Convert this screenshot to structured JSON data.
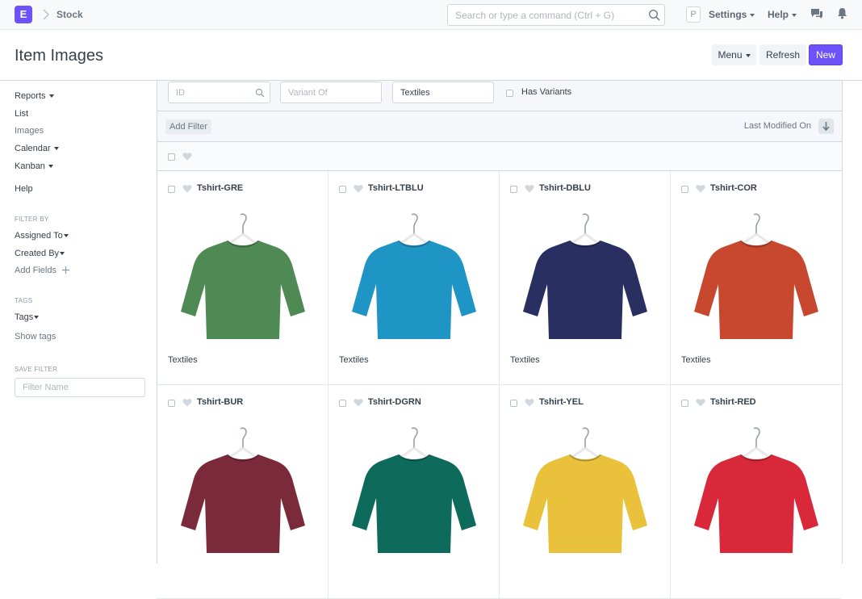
{
  "navbar": {
    "logo_letter": "E",
    "breadcrumb": "Stock",
    "search_placeholder": "Search or type a command (Ctrl + G)",
    "avatar_letter": "P",
    "settings_label": "Settings",
    "help_label": "Help"
  },
  "page": {
    "title": "Item Images",
    "menu_label": "Menu",
    "refresh_label": "Refresh",
    "new_label": "New"
  },
  "colors": {
    "accent": "#6d52fa"
  },
  "sidebar": {
    "reports": "Reports",
    "list": "List",
    "images": "Images",
    "calendar": "Calendar",
    "kanban": "Kanban",
    "help": "Help",
    "filter_by_heading": "FILTER BY",
    "assigned_to": "Assigned To",
    "created_by": "Created By",
    "add_fields": "Add Fields",
    "tags_heading": "TAGS",
    "tags": "Tags",
    "show_tags": "Show tags",
    "save_filter_heading": "SAVE FILTER",
    "filter_name_placeholder": "Filter Name"
  },
  "filters": {
    "id_placeholder": "ID",
    "variant_of_placeholder": "Variant Of",
    "item_group_value": "Textiles",
    "has_variants_label": "Has Variants"
  },
  "toolbar": {
    "add_filter": "Add Filter",
    "sort_label": "Last Modified On"
  },
  "items": [
    {
      "name": "Tshirt-GRE",
      "group": "Textiles",
      "color": "#4f8a55"
    },
    {
      "name": "Tshirt-LTBLU",
      "group": "Textiles",
      "color": "#1f95c6"
    },
    {
      "name": "Tshirt-DBLU",
      "group": "Textiles",
      "color": "#2a2f62"
    },
    {
      "name": "Tshirt-COR",
      "group": "Textiles",
      "color": "#c8482f"
    },
    {
      "name": "Tshirt-BUR",
      "group": "",
      "color": "#7b2a3b"
    },
    {
      "name": "Tshirt-DGRN",
      "group": "",
      "color": "#0e6b5c"
    },
    {
      "name": "Tshirt-YEL",
      "group": "",
      "color": "#e9c13a"
    },
    {
      "name": "Tshirt-RED",
      "group": "",
      "color": "#d8283a"
    }
  ]
}
